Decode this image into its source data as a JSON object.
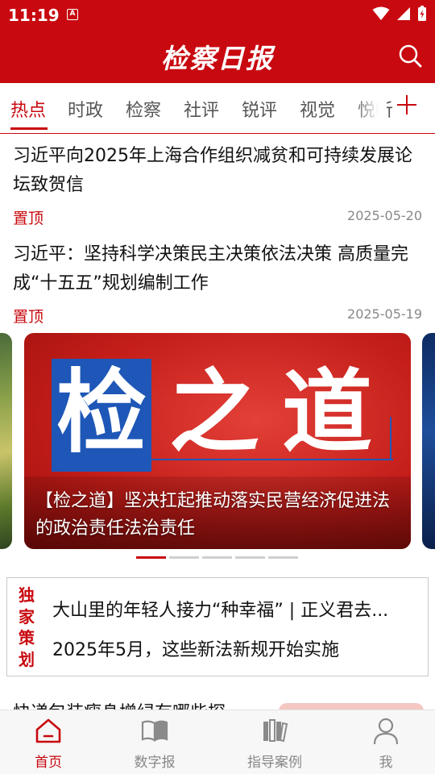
{
  "status_bar": {
    "time": "11:19",
    "notification_glyph": "A"
  },
  "header": {
    "logo_text": "检察日报",
    "search_icon": "search-icon",
    "brand_color": "#c8090f"
  },
  "tabs": [
    {
      "label": "热点",
      "active": true
    },
    {
      "label": "时政"
    },
    {
      "label": "检察"
    },
    {
      "label": "社评"
    },
    {
      "label": "锐评"
    },
    {
      "label": "视觉"
    },
    {
      "label": "悦听"
    }
  ],
  "news": [
    {
      "title": "习近平向2025年上海合作组织减贫和可持续发展论坛致贺信",
      "tag": "置顶",
      "date": "2025-05-20"
    },
    {
      "title": "习近平：坚持科学决策民主决策依法决策 高质量完成“十五五”规划编制工作",
      "tag": "置顶",
      "date": "2025-05-19"
    }
  ],
  "carousel": {
    "brand_text": "检之道",
    "caption": "【检之道】坚决扛起推动落实民营经济促进法的政治责任法治责任",
    "dot_count": 5,
    "active_index": 0
  },
  "feature": {
    "label": "独家策划",
    "items": [
      "大山里的年轻人接力“种幸福” | 正义君去...",
      "2025年5月，这些新法新规开始实施"
    ]
  },
  "partial_item": {
    "title": "快递包装瘦身增绿有哪些探"
  },
  "bottom_nav": [
    {
      "label": "首页",
      "icon": "home-icon",
      "active": true
    },
    {
      "label": "数字报",
      "icon": "book-icon"
    },
    {
      "label": "指导案例",
      "icon": "case-files-icon"
    },
    {
      "label": "我",
      "icon": "user-icon"
    }
  ]
}
